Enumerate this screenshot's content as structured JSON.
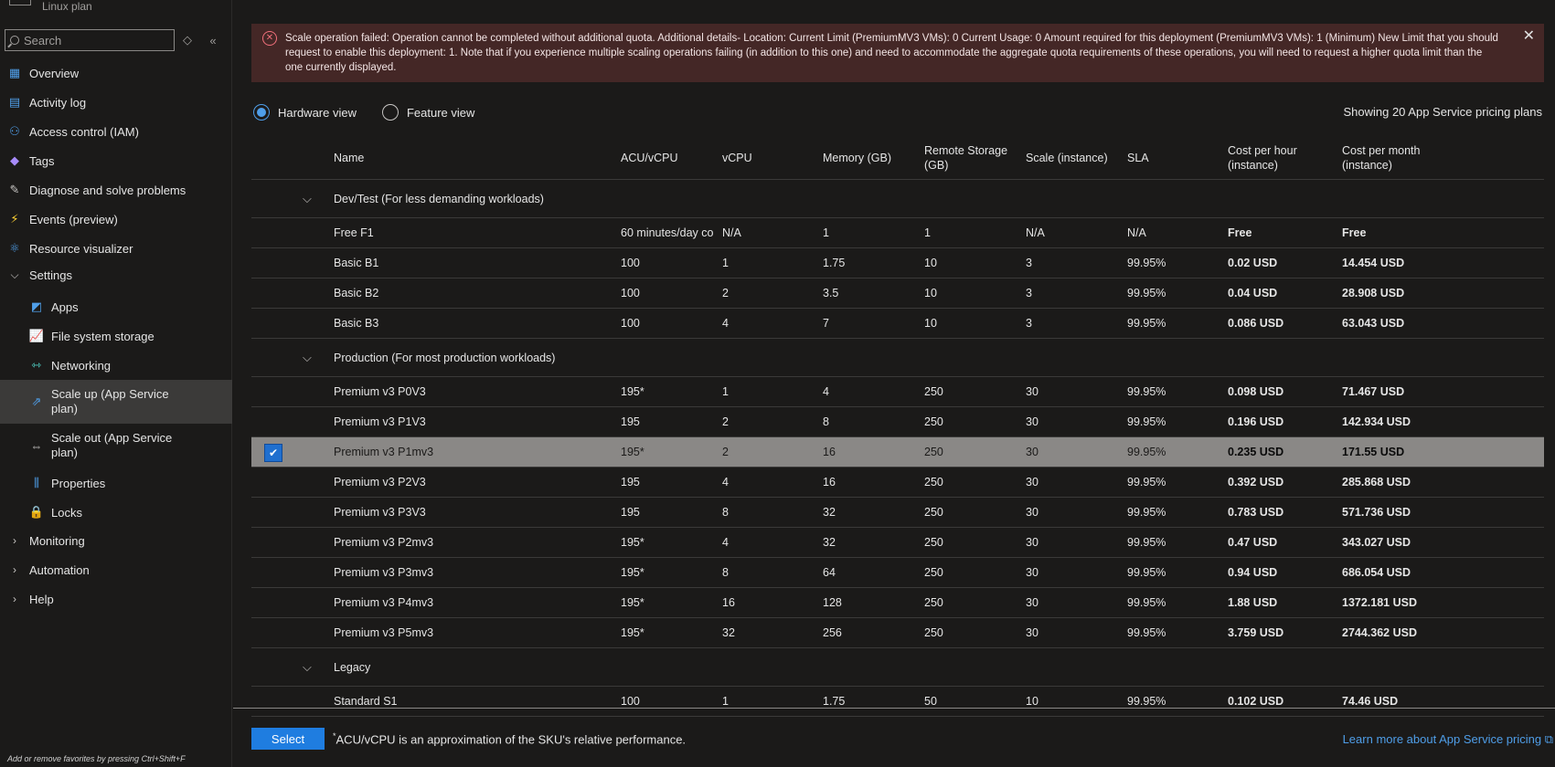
{
  "sidebar": {
    "plan_subtitle": "Linux plan",
    "search_placeholder": "Search",
    "sort_glyph": "◇",
    "collapse_glyph": "«",
    "items": [
      {
        "label": "Overview",
        "icon": "overview-icon",
        "glyph": "▦",
        "color": "#4f9ee8"
      },
      {
        "label": "Activity log",
        "icon": "activity-log-icon",
        "glyph": "▤",
        "color": "#4f9ee8"
      },
      {
        "label": "Access control (IAM)",
        "icon": "people-icon",
        "glyph": "⚇",
        "color": "#4f9ee8"
      },
      {
        "label": "Tags",
        "icon": "tag-icon",
        "glyph": "◆",
        "color": "#a78bfa"
      },
      {
        "label": "Diagnose and solve problems",
        "icon": "wrench-icon",
        "glyph": "✎",
        "color": "#c8c6c4"
      },
      {
        "label": "Events (preview)",
        "icon": "lightning-icon",
        "glyph": "⚡",
        "color": "#ffd335"
      },
      {
        "label": "Resource visualizer",
        "icon": "hierarchy-icon",
        "glyph": "⚛",
        "color": "#4f9ee8"
      },
      {
        "label": "Settings",
        "expanded": true
      },
      {
        "label": "Apps",
        "icon": "apps-icon",
        "glyph": "◩",
        "color": "#4f9ee8"
      },
      {
        "label": "File system storage",
        "icon": "chart-icon",
        "glyph": "📈",
        "color": "#a78bfa"
      },
      {
        "label": "Networking",
        "icon": "networking-icon",
        "glyph": "⇿",
        "color": "#4fd1c5"
      },
      {
        "label": "Scale up (App Service plan)",
        "icon": "scale-up-icon",
        "glyph": "⇗",
        "color": "#4f9ee8",
        "selected": true
      },
      {
        "label": "Scale out (App Service plan)",
        "icon": "scale-out-icon",
        "glyph": "⇔",
        "color": "#c8c6c4"
      },
      {
        "label": "Properties",
        "icon": "properties-icon",
        "glyph": "⫼",
        "color": "#4f9ee8"
      },
      {
        "label": "Locks",
        "icon": "lock-icon",
        "glyph": "🔒",
        "color": "#4f9ee8"
      },
      {
        "label": "Monitoring",
        "expanded": false
      },
      {
        "label": "Automation",
        "expanded": false
      },
      {
        "label": "Help",
        "expanded": false
      }
    ],
    "favorites_hint": "Add or remove favorites by pressing Ctrl+Shift+F"
  },
  "error": {
    "message": "Scale operation failed: Operation cannot be completed without additional quota. Additional details- Location: Current Limit (PremiumMV3 VMs): 0 Current Usage: 0 Amount required for this deployment (PremiumMV3 VMs): 1 (Minimum) New Limit that you should request to enable this deployment: 1. Note that if you experience multiple scaling operations failing (in addition to this one) and need to accommodate the aggregate quota requirements of these operations, you will need to request a higher quota limit than the one currently displayed.",
    "icon_glyph": "✕",
    "close_glyph": "✕"
  },
  "view": {
    "hardware": "Hardware view",
    "feature": "Feature view",
    "showing": "Showing 20 App Service pricing plans"
  },
  "table": {
    "headers": [
      "Name",
      "ACU/vCPU",
      "vCPU",
      "Memory (GB)",
      "Remote Storage (GB)",
      "Scale (instance)",
      "SLA",
      "Cost per hour (instance)",
      "Cost per month (instance)"
    ],
    "groups": [
      {
        "label": "Dev/Test  (For less demanding workloads)",
        "rows": [
          [
            "Free F1",
            "60 minutes/day co",
            "N/A",
            "1",
            "1",
            "N/A",
            "N/A",
            "Free",
            "Free"
          ],
          [
            "Basic B1",
            "100",
            "1",
            "1.75",
            "10",
            "3",
            "99.95%",
            "0.02 USD",
            "14.454 USD"
          ],
          [
            "Basic B2",
            "100",
            "2",
            "3.5",
            "10",
            "3",
            "99.95%",
            "0.04 USD",
            "28.908 USD"
          ],
          [
            "Basic B3",
            "100",
            "4",
            "7",
            "10",
            "3",
            "99.95%",
            "0.086 USD",
            "63.043 USD"
          ]
        ]
      },
      {
        "label": "Production  (For most production workloads)",
        "rows": [
          [
            "Premium v3 P0V3",
            "195*",
            "1",
            "4",
            "250",
            "30",
            "99.95%",
            "0.098 USD",
            "71.467 USD"
          ],
          [
            "Premium v3 P1V3",
            "195",
            "2",
            "8",
            "250",
            "30",
            "99.95%",
            "0.196 USD",
            "142.934 USD"
          ],
          [
            "Premium v3 P1mv3",
            "195*",
            "2",
            "16",
            "250",
            "30",
            "99.95%",
            "0.235 USD",
            "171.55 USD"
          ],
          [
            "Premium v3 P2V3",
            "195",
            "4",
            "16",
            "250",
            "30",
            "99.95%",
            "0.392 USD",
            "285.868 USD"
          ],
          [
            "Premium v3 P3V3",
            "195",
            "8",
            "32",
            "250",
            "30",
            "99.95%",
            "0.783 USD",
            "571.736 USD"
          ],
          [
            "Premium v3 P2mv3",
            "195*",
            "4",
            "32",
            "250",
            "30",
            "99.95%",
            "0.47 USD",
            "343.027 USD"
          ],
          [
            "Premium v3 P3mv3",
            "195*",
            "8",
            "64",
            "250",
            "30",
            "99.95%",
            "0.94 USD",
            "686.054 USD"
          ],
          [
            "Premium v3 P4mv3",
            "195*",
            "16",
            "128",
            "250",
            "30",
            "99.95%",
            "1.88 USD",
            "1372.181 USD"
          ],
          [
            "Premium v3 P5mv3",
            "195*",
            "32",
            "256",
            "250",
            "30",
            "99.95%",
            "3.759 USD",
            "2744.362 USD"
          ]
        ]
      },
      {
        "label": "Legacy",
        "rows": [
          [
            "Standard S1",
            "100",
            "1",
            "1.75",
            "50",
            "10",
            "99.95%",
            "0.102 USD",
            "74.46 USD"
          ]
        ]
      }
    ],
    "selected_name": "Premium v3 P1mv3",
    "check_glyph": "✔",
    "group_chevron": "⌵"
  },
  "footer": {
    "select_label": "Select",
    "footnote_mark": "*",
    "footnote": "ACU/vCPU is an approximation of the SKU's relative performance.",
    "learn_more": "Learn more about App Service pricing ⧉"
  }
}
